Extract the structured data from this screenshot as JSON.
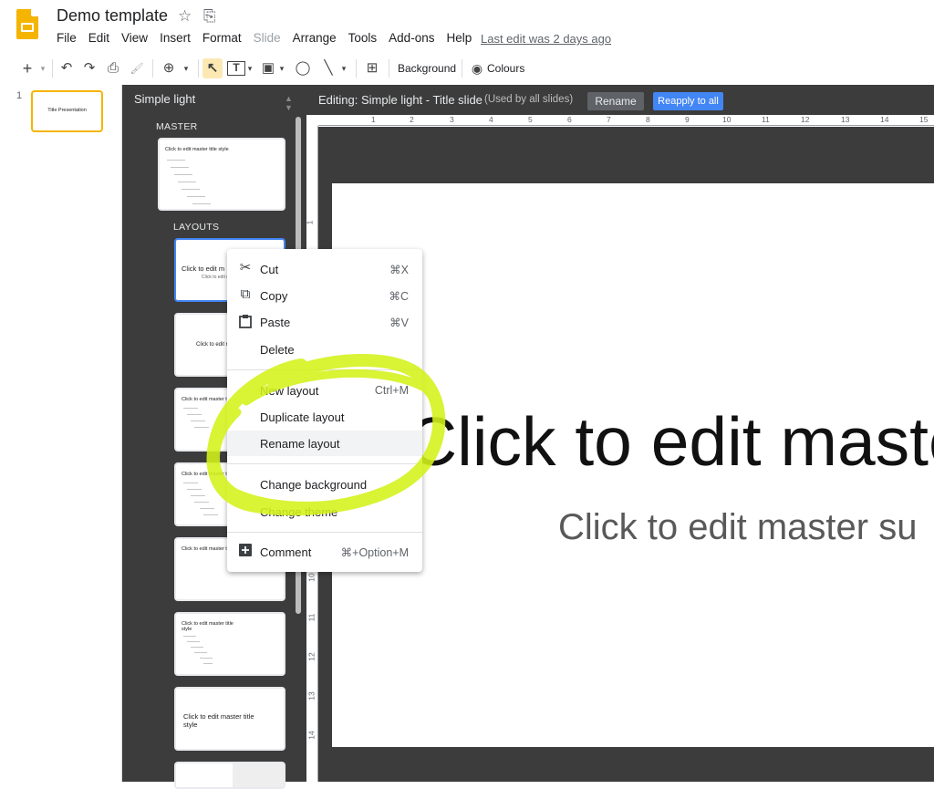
{
  "header": {
    "title": "Demo template",
    "star_icon": "☆",
    "move_icon": "⎘",
    "last_edit": "Last edit was 2 days ago",
    "menu": [
      {
        "label": "File",
        "disabled": false
      },
      {
        "label": "Edit",
        "disabled": false
      },
      {
        "label": "View",
        "disabled": false
      },
      {
        "label": "Insert",
        "disabled": false
      },
      {
        "label": "Format",
        "disabled": false
      },
      {
        "label": "Slide",
        "disabled": true
      },
      {
        "label": "Arrange",
        "disabled": false
      },
      {
        "label": "Tools",
        "disabled": false
      },
      {
        "label": "Add-ons",
        "disabled": false
      },
      {
        "label": "Help",
        "disabled": false
      }
    ]
  },
  "toolbar": {
    "new_slide": "+",
    "undo": "↶",
    "redo": "↷",
    "print": "⎙",
    "paint_format": "🖌",
    "zoom": "⊕",
    "select": "↖",
    "textbox": "T",
    "image": "▣",
    "shape": "◯",
    "line": "╲",
    "comment": "⊞",
    "background_label": "Background",
    "colours_label": "Colours",
    "dropdown_caret": "▾"
  },
  "filmstrip": {
    "slide_number": "1",
    "slide_title": "Title Presentation"
  },
  "theme_panel": {
    "theme_name": "Simple light",
    "master_label": "MASTER",
    "layouts_label": "LAYOUTS",
    "master_thumb_title": "Click to edit master title style",
    "layouts": [
      {
        "title": "Click to edit m",
        "subtitle": "Click to edit m"
      },
      {
        "title": "Click to edit m"
      },
      {
        "title": "Click to edit master title s"
      },
      {
        "title": "Click to edit master title s"
      },
      {
        "title": "Click to edit master title s"
      },
      {
        "title": "Click to edit master title style"
      },
      {
        "title": "Click to edit master title style"
      },
      {
        "title": ""
      }
    ]
  },
  "editing_bar": {
    "editing_text": "Editing: Simple light - Title slide",
    "used_by": "(Used by all slides)",
    "rename_label": "Rename",
    "reapply_label": "Reapply to all"
  },
  "rulers": {
    "top": [
      "1",
      "2",
      "3",
      "4",
      "5",
      "6",
      "7",
      "8",
      "9",
      "10",
      "11",
      "12",
      "13",
      "14",
      "15"
    ],
    "left": [
      "1",
      "10",
      "11",
      "12",
      "13",
      "14"
    ]
  },
  "slide": {
    "title": "Click to edit maste",
    "subtitle": "Click to edit master su"
  },
  "context_menu": {
    "items": [
      {
        "label": "Cut",
        "shortcut": "⌘X",
        "icon": "scissors-icon",
        "glyph": "✂"
      },
      {
        "label": "Copy",
        "shortcut": "⌘C",
        "icon": "copy-icon",
        "glyph": "⧉"
      },
      {
        "label": "Paste",
        "shortcut": "⌘V",
        "icon": "paste-icon",
        "glyph": "📋"
      },
      {
        "label": "Delete",
        "shortcut": ""
      },
      {
        "label": "New layout",
        "shortcut": "Ctrl+M"
      },
      {
        "label": "Duplicate layout",
        "shortcut": ""
      },
      {
        "label": "Rename layout",
        "shortcut": ""
      },
      {
        "label": "Change background",
        "shortcut": ""
      },
      {
        "label": "Change theme",
        "shortcut": ""
      },
      {
        "label": "Comment",
        "shortcut": "⌘+Option+M",
        "icon": "add-comment-icon",
        "glyph": "⊞"
      }
    ]
  },
  "colors": {
    "accent": "#4285f4",
    "brand_yellow": "#f4b400",
    "highlighter": "#d4f21a",
    "dark_panel": "#3c3c3c"
  }
}
